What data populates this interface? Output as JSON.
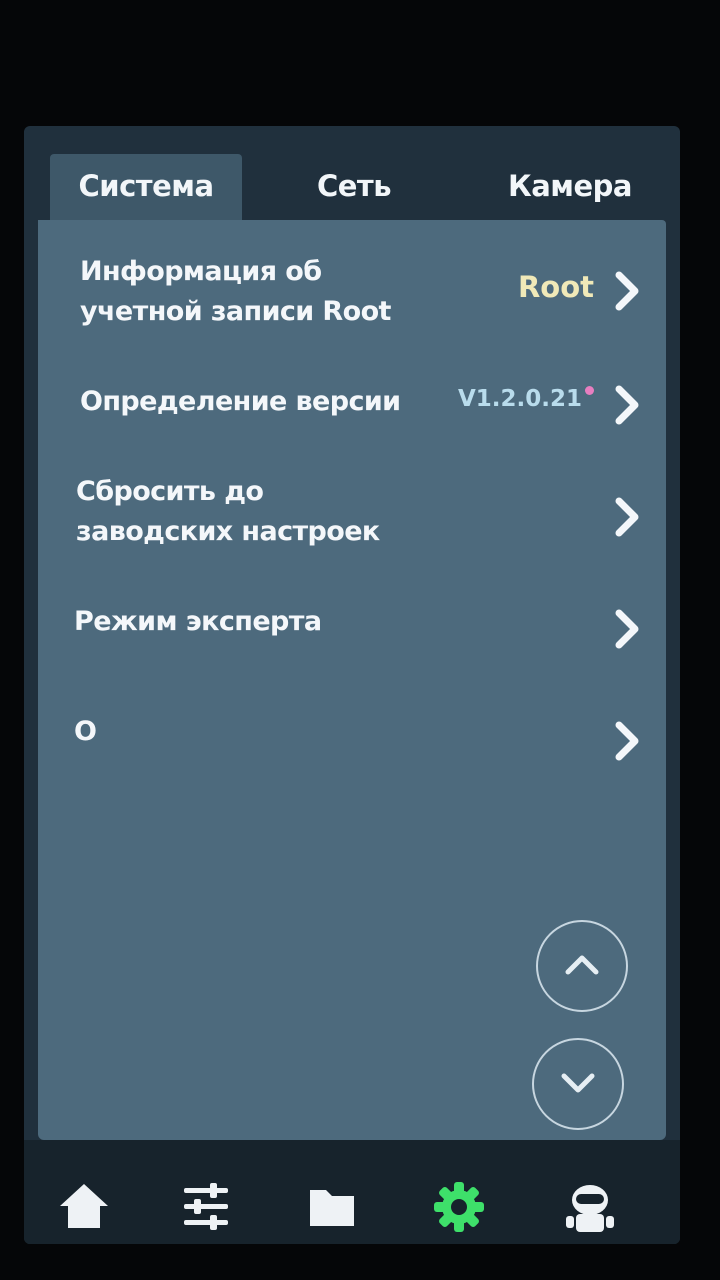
{
  "tabs": [
    {
      "label": "Система",
      "active": true
    },
    {
      "label": "Сеть",
      "active": false
    },
    {
      "label": "Камера",
      "active": false
    }
  ],
  "settings": [
    {
      "label_line1": "Информация об",
      "label_line2": "учетной записи Root",
      "value": "Root",
      "icon": "chevron-right-icon"
    },
    {
      "label_line1": "Определение версии",
      "value": "V1.2.0.21",
      "has_update_dot": true,
      "icon": "chevron-right-icon"
    },
    {
      "label_line1": "Сбросить до",
      "label_line2": "заводских настроек",
      "icon": "chevron-right-icon"
    },
    {
      "label_line1": "Режим эксперта",
      "icon": "chevron-right-icon"
    },
    {
      "label_line1": "О",
      "icon": "chevron-right-icon"
    }
  ],
  "scroll": {
    "up_icon": "chevron-up-icon",
    "down_icon": "chevron-down-icon"
  },
  "bottom_nav": [
    {
      "icon": "home-icon",
      "active": false
    },
    {
      "icon": "sliders-icon",
      "active": false
    },
    {
      "icon": "folder-icon",
      "active": false
    },
    {
      "icon": "gear-icon",
      "active": true
    },
    {
      "icon": "robot-icon",
      "active": false
    }
  ],
  "colors": {
    "panel": "#4d6a7d",
    "active_tab": "#3e5869",
    "root_value": "#f0e9b8",
    "version_value": "#b9dcec",
    "update_dot": "#e87ec0",
    "active_nav": "#3ee06a",
    "nav_icon": "#eef2f5"
  }
}
